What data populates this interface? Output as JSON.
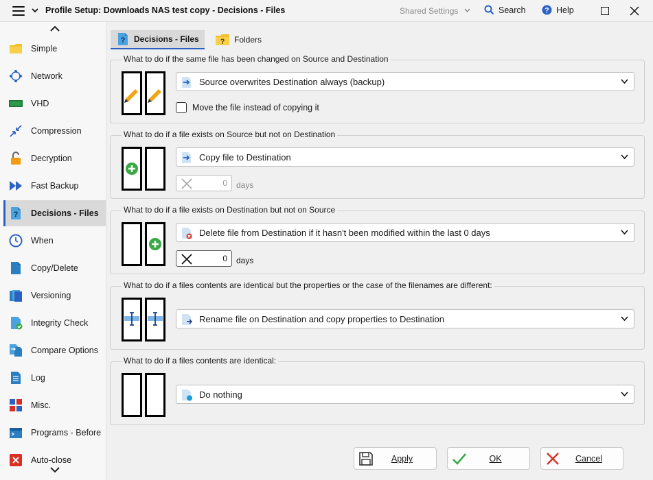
{
  "window": {
    "title": "Profile Setup: Downloads NAS test copy - Decisions - Files",
    "shared_settings": "Shared Settings",
    "search": "Search",
    "help": "Help"
  },
  "sidebar": {
    "items": [
      {
        "label": "Simple",
        "icon": "folder-icon"
      },
      {
        "label": "Network",
        "icon": "network-icon"
      },
      {
        "label": "VHD",
        "icon": "vhd-icon"
      },
      {
        "label": "Compression",
        "icon": "compression-icon"
      },
      {
        "label": "Decryption",
        "icon": "unlock-icon"
      },
      {
        "label": "Fast Backup",
        "icon": "fast-forward-icon"
      },
      {
        "label": "Decisions - Files",
        "icon": "question-file-icon"
      },
      {
        "label": "When",
        "icon": "clock-icon"
      },
      {
        "label": "Copy/Delete",
        "icon": "file-icon"
      },
      {
        "label": "Versioning",
        "icon": "versions-icon"
      },
      {
        "label": "Integrity Check",
        "icon": "check-file-icon"
      },
      {
        "label": "Compare Options",
        "icon": "compare-icon"
      },
      {
        "label": "Log",
        "icon": "log-icon"
      },
      {
        "label": "Misc.",
        "icon": "misc-icon"
      },
      {
        "label": "Programs - Before",
        "icon": "programs-icon"
      },
      {
        "label": "Auto-close",
        "icon": "auto-close-icon"
      }
    ],
    "active": "Decisions - Files"
  },
  "tabs": [
    {
      "label": "Decisions - Files"
    },
    {
      "label": "Folders"
    }
  ],
  "groups": {
    "changed": {
      "title": "What to do if the same file has been changed on Source and Destination",
      "selected": "Source overwrites Destination always (backup)",
      "checkbox_label": "Move the file instead of copying it"
    },
    "source_only": {
      "title": "What to do if a file exists on Source but not on Destination",
      "selected": "Copy file to Destination",
      "days_value": "0",
      "days_label": "days"
    },
    "dest_only": {
      "title": "What to do if a file exists on Destination but not on Source",
      "selected": "Delete file from Destination if it hasn't been modified within the last 0 days",
      "days_value": "0",
      "days_label": "days"
    },
    "props_differ": {
      "title": "What to do if a files contents are identical but the properties or the case of the filenames are different:",
      "selected": "Rename file on Destination and copy properties to Destination"
    },
    "identical": {
      "title": "What to do if a files contents are identical:",
      "selected": "Do nothing"
    }
  },
  "buttons": {
    "apply": "Apply",
    "ok": "OK",
    "cancel": "Cancel"
  },
  "colors": {
    "accent": "#2b62c2",
    "pencil": "#f2a413",
    "green": "#3aa845",
    "red": "#d93025"
  }
}
